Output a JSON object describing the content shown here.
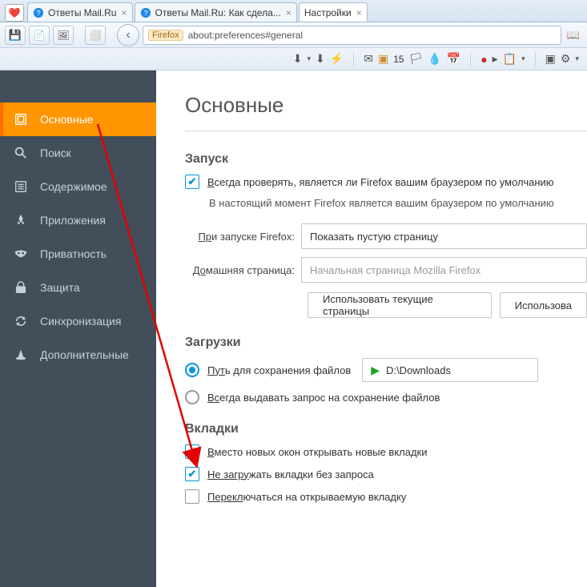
{
  "tabs": [
    {
      "label": "Ответы Mail.Ru"
    },
    {
      "label": "Ответы Mail.Ru: Как сдела..."
    },
    {
      "label": "Настройки",
      "active": true
    }
  ],
  "url": {
    "chip": "Firefox",
    "value": "about:preferences#general"
  },
  "toolbar2": {
    "badge": "15"
  },
  "sidebar": {
    "items": [
      {
        "label": "Основные",
        "active": true
      },
      {
        "label": "Поиск"
      },
      {
        "label": "Содержимое"
      },
      {
        "label": "Приложения"
      },
      {
        "label": "Приватность"
      },
      {
        "label": "Защита"
      },
      {
        "label": "Синхронизация"
      },
      {
        "label": "Дополнительные"
      }
    ]
  },
  "page": {
    "title": "Основные",
    "startup": {
      "heading": "Запуск",
      "always_check_prefix": "В",
      "always_check_rest": "сегда проверять, является ли Firefox вашим браузером по умолчанию",
      "default_info": "В настоящий момент Firefox является вашим браузером по умолчанию",
      "on_start_label_prefix": "Пр",
      "on_start_label_rest": "и запуске Firefox:",
      "on_start_value": "Показать пустую страницу",
      "home_label_prefix": "До",
      "home_label_rest": "машняя страница:",
      "home_placeholder": "Начальная страница Mozilla Firefox",
      "use_current": "Использовать текущие страницы",
      "use_bookmark": "Использова"
    },
    "downloads": {
      "heading": "Загрузки",
      "save_to_prefix": "Пут",
      "save_to_rest": "ь для сохранения файлов",
      "path": "D:\\Downloads",
      "always_ask_prefix": "Вс",
      "always_ask_rest": "егда выдавать запрос на сохранение файлов"
    },
    "tabs_section": {
      "heading": "Вкладки",
      "instead_windows_prefix": "В",
      "instead_windows_rest": "место новых окон открывать новые вкладки",
      "dont_load_prefix": "Не загру",
      "dont_load_rest": "жать вкладки без запроса",
      "switch_to_prefix": "Перекл",
      "switch_to_rest": "ючаться на открываемую вкладку"
    }
  }
}
